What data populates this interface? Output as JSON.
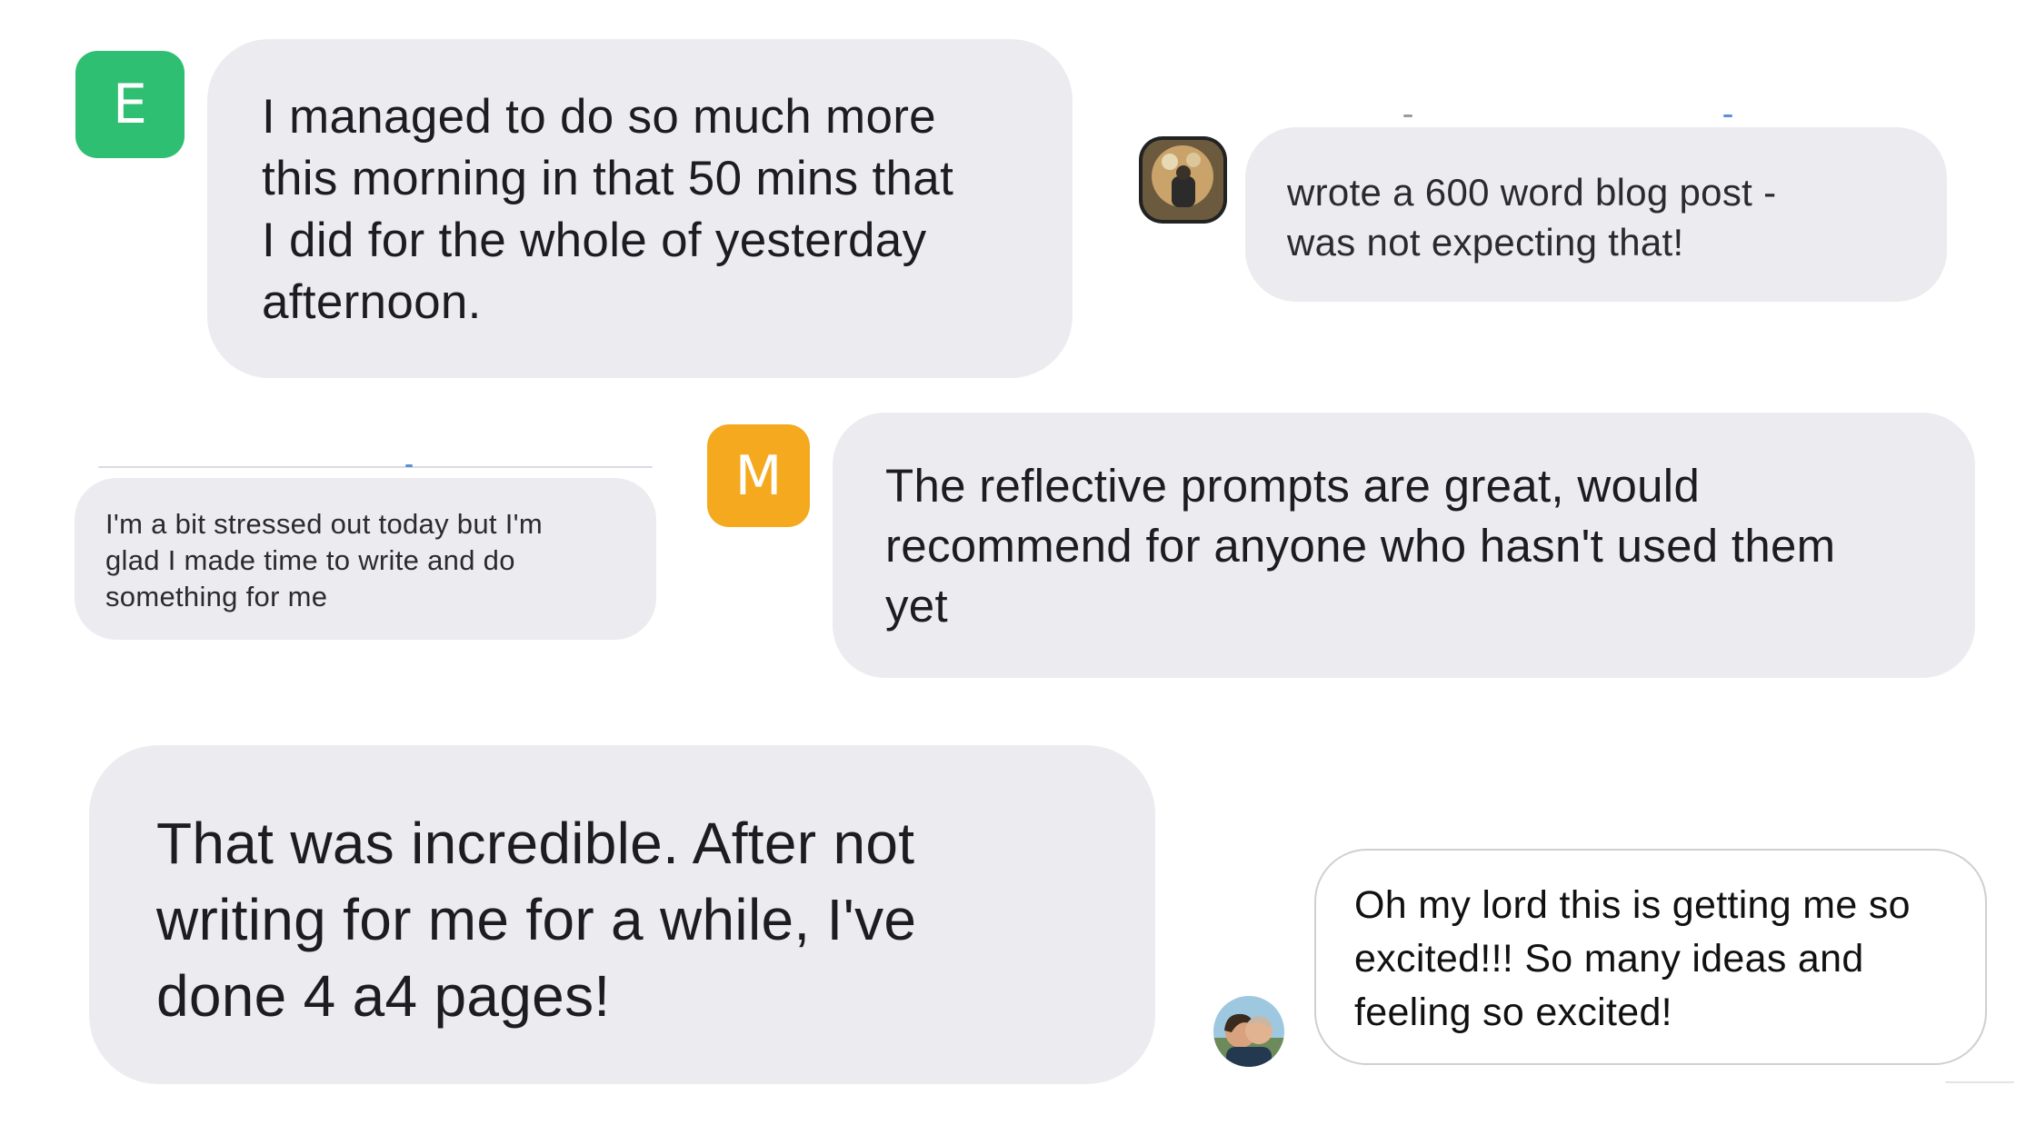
{
  "colors": {
    "bubble_bg": "#ececf0",
    "avatar_e": "#2fbf73",
    "avatar_m": "#f4a91f",
    "text": "#1d1d1f",
    "outline": "#cfcfd4"
  },
  "messages": [
    {
      "id": "msg-e",
      "avatar": {
        "type": "letter",
        "letter": "E"
      },
      "text": "I managed to do so much more\nthis morning in that 50 mins that\nI did for the whole of yesterday\nafternoon."
    },
    {
      "id": "msg-blog",
      "avatar": {
        "type": "photo",
        "icon": "profile-photo-icon"
      },
      "text": "wrote a 600 word blog post -\nwas not expecting that!"
    },
    {
      "id": "msg-stressed",
      "text": "I'm a bit stressed out today but I'm\nglad I made time to write and do\nsomething for me"
    },
    {
      "id": "msg-m",
      "avatar": {
        "type": "letter",
        "letter": "M"
      },
      "text": "The reflective prompts are great, would\nrecommend for anyone who hasn't used them\nyet"
    },
    {
      "id": "msg-incredible",
      "text": "That was incredible. After not\nwriting for me for a while, I've\ndone 4 a4 pages!"
    },
    {
      "id": "msg-excited",
      "avatar": {
        "type": "photo",
        "icon": "couple-photo-icon"
      },
      "text": "Oh my lord this is getting me so\nexcited!!! So many ideas and\nfeeling so excited!"
    }
  ]
}
